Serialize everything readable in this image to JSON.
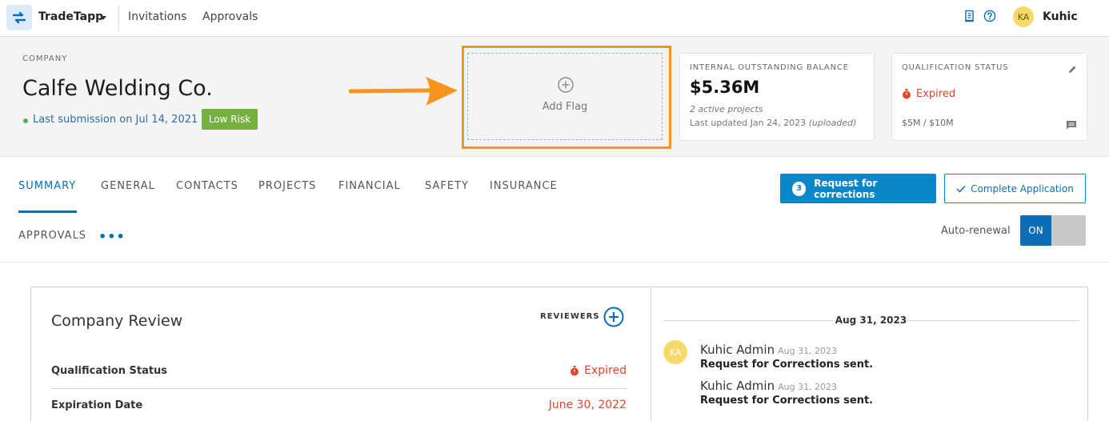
{
  "nav": {
    "app_name": "TradeTapp",
    "links": [
      "Invitations",
      "Approvals"
    ],
    "user_initials": "KA",
    "user_name": "Kuhic"
  },
  "header": {
    "company_label": "COMPANY",
    "company_name": "Calfe Welding Co.",
    "last_submission": "Last submission on Jul 14, 2021",
    "risk_badge": "Low Risk",
    "add_flag": "Add Flag"
  },
  "balance_card": {
    "label": "INTERNAL OUTSTANDING BALANCE",
    "value": "$5.36M",
    "projects": "2 active projects",
    "updated": "Last updated Jan 24, 2023",
    "updated_note": "(uploaded)"
  },
  "qualification_card": {
    "label": "QUALIFICATION STATUS",
    "status": "Expired",
    "range": "$5M / $10M"
  },
  "tabs": [
    "SUMMARY",
    "GENERAL",
    "CONTACTS",
    "PROJECTS",
    "FINANCIAL",
    "SAFETY",
    "INSURANCE",
    "APPROVALS"
  ],
  "more_tabs": "•••",
  "actions": {
    "request_count": "3",
    "request_label": "Request for corrections",
    "complete_label": "Complete Application",
    "autorenew_label": "Auto-renewal",
    "toggle_state": "ON"
  },
  "review": {
    "title": "Company Review",
    "reviewers_label": "REVIEWERS",
    "rows": [
      {
        "label": "Qualification Status",
        "value": "Expired"
      },
      {
        "label": "Expiration Date",
        "value": "June 30, 2022"
      }
    ]
  },
  "activity": {
    "date": "Aug 31, 2023",
    "avatar_initials": "KA",
    "entries": [
      {
        "name": "Kuhic Admin",
        "date": "Aug 31, 2023",
        "message": "Request for Corrections sent."
      },
      {
        "name": "Kuhic Admin",
        "date": "Aug 31, 2023",
        "message": "Request for Corrections sent."
      }
    ]
  },
  "colors": {
    "brand_blue": "#0b6fb8",
    "button_blue": "#0b86c8",
    "expired_red": "#e0452d",
    "low_risk_green": "#76b041",
    "highlight_orange": "#f7941e"
  }
}
